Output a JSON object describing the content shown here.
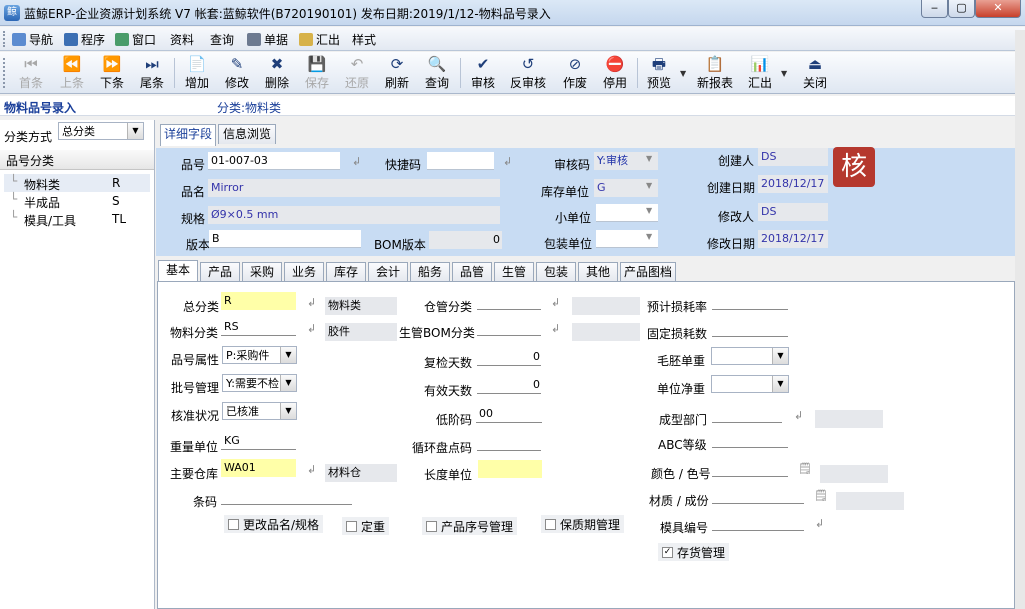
{
  "window": {
    "title": "蓝鲸ERP-企业资源计划系统 V7 帐套:蓝鲸软件(B720190101) 发布日期:2019/1/12-物料品号录入",
    "minimize": "‒",
    "maximize": "▢",
    "close": "✕"
  },
  "menu": [
    "导航",
    "程序",
    "窗口",
    "资料",
    "查询",
    "单据",
    "汇出",
    "样式"
  ],
  "toolbar": {
    "first": "首条",
    "prev": "上条",
    "next": "下条",
    "last": "尾条",
    "add": "增加",
    "edit": "修改",
    "delete": "删除",
    "save": "保存",
    "undo": "还原",
    "refresh": "刷新",
    "query": "查询",
    "approve": "审核",
    "unapprove": "反审核",
    "void": "作废",
    "disable": "停用",
    "preview": "预览",
    "newreport": "新报表",
    "export": "汇出",
    "close": "关闭"
  },
  "subheader": {
    "title": "物料品号录入",
    "category": "分类:物料类"
  },
  "left": {
    "classify_label": "分类方式",
    "classify_value": "总分类",
    "tree_title": "品号分类",
    "items": [
      {
        "name": "物料类",
        "code": "R"
      },
      {
        "name": "半成品",
        "code": "S"
      },
      {
        "name": "模具/工具",
        "code": "TL"
      }
    ]
  },
  "top_tabs": [
    "详细字段",
    "信息浏览"
  ],
  "header": {
    "item_no_label": "品号",
    "item_no": "01-007-03",
    "quick_code_label": "快捷码",
    "quick_code": "",
    "audit_code_label": "审核码",
    "audit_code": "Y:审核",
    "creator_label": "创建人",
    "creator": "DS",
    "name_label": "品名",
    "name": "Mirror",
    "stock_unit_label": "库存单位",
    "stock_unit": "G",
    "create_date_label": "创建日期",
    "create_date": "2018/12/17",
    "spec_label": "规格",
    "spec": "Ø9×0.5 mm",
    "small_unit_label": "小单位",
    "small_unit": "",
    "modifier_label": "修改人",
    "modifier": "DS",
    "version_label": "版本",
    "version": "B",
    "bom_version_label": "BOM版本",
    "bom_version": "0",
    "pack_unit_label": "包装单位",
    "pack_unit": "",
    "modify_date_label": "修改日期",
    "modify_date": "2018/12/17",
    "stamp": "核"
  },
  "detail_tabs": [
    "基本",
    "产品",
    "采购",
    "业务",
    "库存",
    "会计",
    "船务",
    "品管",
    "生管",
    "包装",
    "其他",
    "产品图档"
  ],
  "basic": {
    "main_category_label": "总分类",
    "main_category": "R",
    "main_category_name": "物料类",
    "item_category_label": "物料分类",
    "item_category": "RS",
    "item_category_name": "胶件",
    "attr_label": "品号属性",
    "attr": "P:采购件",
    "lot_label": "批号管理",
    "lot": "Y:需要不检",
    "approve_label": "核准状况",
    "approve": "已核准",
    "weight_unit_label": "重量单位",
    "weight_unit": "KG",
    "main_wh_label": "主要仓库",
    "main_wh": "WA01",
    "main_wh_name": "材料仓",
    "barcode_label": "条码",
    "barcode": "",
    "wh_category_label": "仓管分类",
    "wh_category": "",
    "bom_category_label": "生管BOM分类",
    "bom_category": "",
    "recheck_days_label": "复检天数",
    "recheck_days": "0",
    "valid_days_label": "有效天数",
    "valid_days": "0",
    "low_level_label": "低阶码",
    "low_level": "00",
    "cycle_count_label": "循环盘点码",
    "cycle_count": "",
    "length_unit_label": "长度单位",
    "length_unit": "",
    "loss_rate_label": "预计损耗率",
    "loss_rate": "",
    "fixed_loss_label": "固定损耗数",
    "fixed_loss": "",
    "gross_weight_label": "毛胚单重",
    "gross_weight": "",
    "net_weight_label": "单位净重",
    "net_weight": "",
    "molding_dept_label": "成型部门",
    "molding_dept": "",
    "abc_label": "ABC等级",
    "abc": "",
    "color_label": "颜色 / 色号",
    "color": "",
    "material_label": "材质 / 成份",
    "material": "",
    "mold_no_label": "模具编号",
    "mold_no": "",
    "cb_change_name": "更改品名/规格",
    "cb_fixed_weight": "定重",
    "cb_serial": "产品序号管理",
    "cb_shelf_life": "保质期管理",
    "cb_inventory": "存货管理"
  },
  "colors": {
    "accent": "#1f3f7a",
    "form_bg": "#c8dcf3",
    "highlight": "#ffffa8",
    "stamp": "#b5382e"
  }
}
